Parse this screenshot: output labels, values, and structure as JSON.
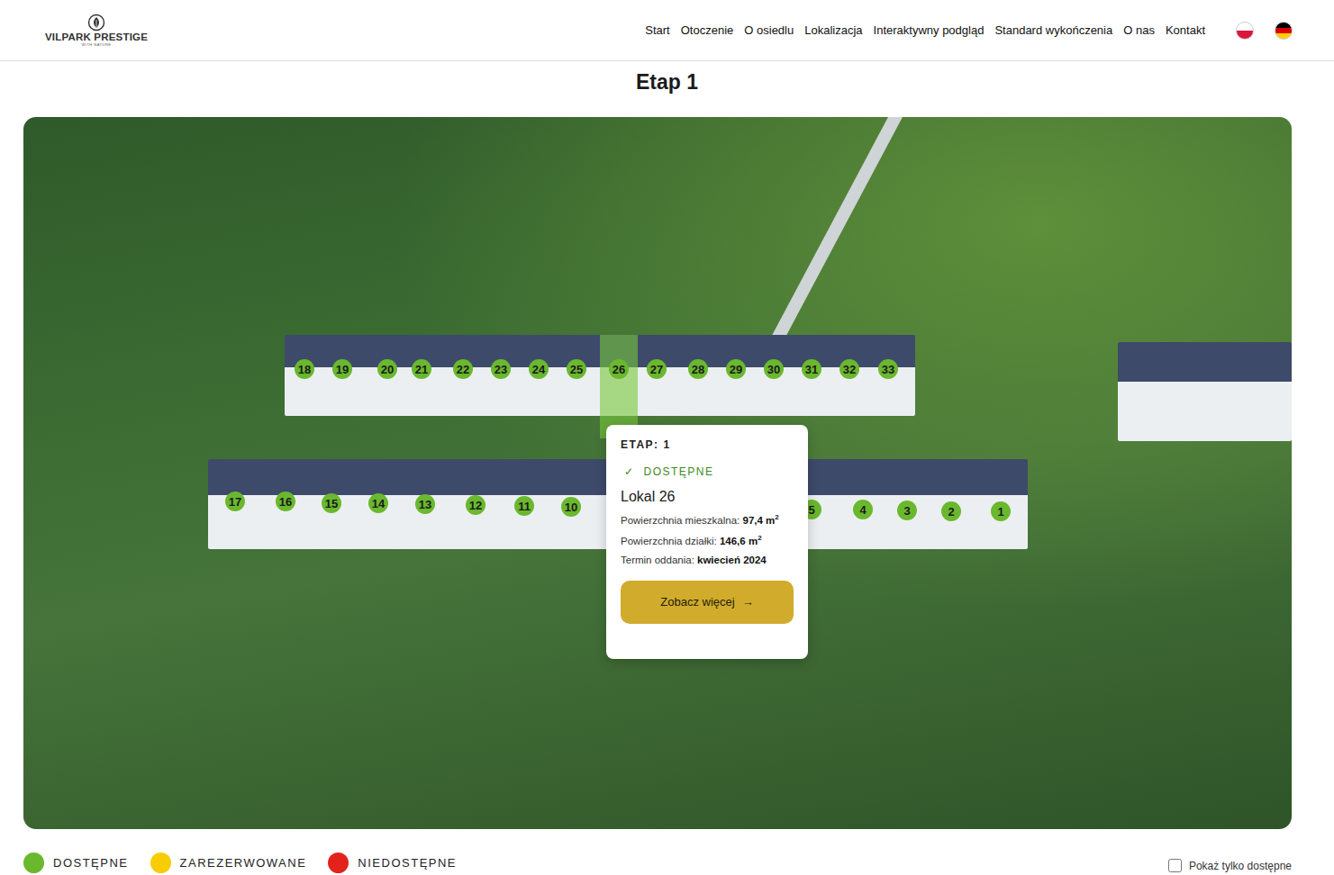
{
  "header": {
    "logo": {
      "name": "VILPARK PRESTIGE",
      "tagline": "WITH NATURE"
    },
    "nav": [
      "Start",
      "Otoczenie",
      "O osiedlu",
      "Lokalizacja",
      "Interaktywny podgląd",
      "Standard wykończenia",
      "O nas",
      "Kontakt"
    ],
    "languages": [
      {
        "kind": "pl"
      },
      {
        "kind": "de"
      }
    ]
  },
  "title": "Etap 1",
  "map": {
    "pins": [
      {
        "number": "18",
        "status": "available",
        "selected": false
      },
      {
        "number": "19",
        "status": "available",
        "selected": false
      },
      {
        "number": "20",
        "status": "available",
        "selected": false
      },
      {
        "number": "21",
        "status": "available",
        "selected": false
      },
      {
        "number": "22",
        "status": "available",
        "selected": false
      },
      {
        "number": "23",
        "status": "available",
        "selected": false
      },
      {
        "number": "24",
        "status": "available",
        "selected": false
      },
      {
        "number": "25",
        "status": "available",
        "selected": false
      },
      {
        "number": "26",
        "status": "available",
        "selected": true
      },
      {
        "number": "27",
        "status": "available",
        "selected": false
      },
      {
        "number": "28",
        "status": "available",
        "selected": false
      },
      {
        "number": "29",
        "status": "available",
        "selected": false
      },
      {
        "number": "30",
        "status": "available",
        "selected": false
      },
      {
        "number": "31",
        "status": "available",
        "selected": false
      },
      {
        "number": "32",
        "status": "available",
        "selected": false
      },
      {
        "number": "33",
        "status": "available",
        "selected": false
      },
      {
        "number": "17",
        "status": "available",
        "selected": false
      },
      {
        "number": "16",
        "status": "available",
        "selected": false
      },
      {
        "number": "15",
        "status": "available",
        "selected": false
      },
      {
        "number": "14",
        "status": "available",
        "selected": false
      },
      {
        "number": "13",
        "status": "available",
        "selected": false
      },
      {
        "number": "12",
        "status": "available",
        "selected": false
      },
      {
        "number": "11",
        "status": "available",
        "selected": false
      },
      {
        "number": "10",
        "status": "available",
        "selected": false
      },
      {
        "number": "5",
        "status": "available",
        "selected": false
      },
      {
        "number": "4",
        "status": "available",
        "selected": false
      },
      {
        "number": "3",
        "status": "available",
        "selected": false
      },
      {
        "number": "2",
        "status": "available",
        "selected": false
      },
      {
        "number": "1",
        "status": "available",
        "selected": false
      }
    ],
    "tooltip": {
      "stage": "ETAP: 1",
      "status_icon": "✓",
      "status": "DOSTĘPNE",
      "title": "Lokal 26",
      "rows": [
        {
          "label": "Powierzchnia mieszkalna:",
          "value": "97,4 m",
          "sup": "2"
        },
        {
          "label": "Powierzchnia działki:",
          "value": "146,6 m",
          "sup": "2"
        },
        {
          "label": "Termin oddania:",
          "value": "kwiecień 2024",
          "sup": ""
        }
      ],
      "button": "Zobacz więcej",
      "button_icon": "→"
    }
  },
  "legend": [
    {
      "label": "DOSTĘPNE",
      "status": "available",
      "color": "#6ab82e"
    },
    {
      "label": "ZAREZERWOWANE",
      "status": "reserved",
      "color": "#f7cd00"
    },
    {
      "label": "NIEDOSTĘPNE",
      "status": "unavailable",
      "color": "#e3231b"
    }
  ],
  "filter": {
    "label": "Pokaż tylko dostępne",
    "checked": false
  }
}
